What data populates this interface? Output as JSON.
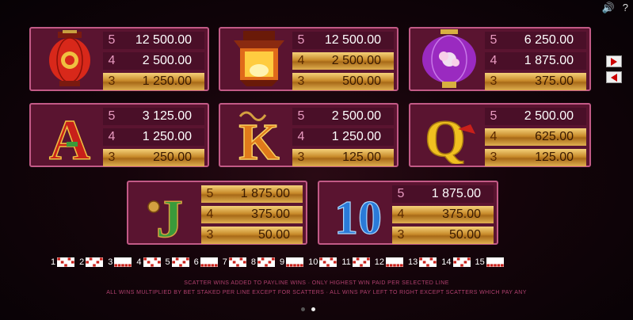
{
  "controls": {
    "sound_icon": "speaker-icon",
    "help_label": "?"
  },
  "paytable": [
    {
      "symbol": "red-lantern",
      "pays": [
        [
          "5",
          "12 500.00"
        ],
        [
          "4",
          "2 500.00"
        ],
        [
          "3",
          "1 250.00"
        ]
      ]
    },
    {
      "symbol": "gold-lantern",
      "pays": [
        [
          "5",
          "12 500.00"
        ],
        [
          "4",
          "2 500.00"
        ],
        [
          "3",
          "500.00"
        ]
      ]
    },
    {
      "symbol": "purple-lantern",
      "pays": [
        [
          "5",
          "6 250.00"
        ],
        [
          "4",
          "1 875.00"
        ],
        [
          "3",
          "375.00"
        ]
      ]
    },
    {
      "symbol": "A",
      "pays": [
        [
          "5",
          "3 125.00"
        ],
        [
          "4",
          "1 250.00"
        ],
        [
          "3",
          "250.00"
        ]
      ]
    },
    {
      "symbol": "K",
      "pays": [
        [
          "5",
          "2 500.00"
        ],
        [
          "4",
          "1 250.00"
        ],
        [
          "3",
          "125.00"
        ]
      ]
    },
    {
      "symbol": "Q",
      "pays": [
        [
          "5",
          "2 500.00"
        ],
        [
          "4",
          "625.00"
        ],
        [
          "3",
          "125.00"
        ]
      ]
    },
    {
      "symbol": "J",
      "pays": [
        [
          "5",
          "1 875.00"
        ],
        [
          "4",
          "375.00"
        ],
        [
          "3",
          "50.00"
        ]
      ]
    },
    {
      "symbol": "10",
      "pays": [
        [
          "5",
          "1 875.00"
        ],
        [
          "4",
          "375.00"
        ],
        [
          "3",
          "50.00"
        ]
      ]
    }
  ],
  "paylines": [
    "1",
    "2",
    "3",
    "4",
    "5",
    "6",
    "7",
    "8",
    "9",
    "10",
    "11",
    "12",
    "13",
    "14",
    "15"
  ],
  "footer": {
    "line1": "SCATTER WINS ADDED TO PAYLINE WINS  ·  ONLY HIGHEST WIN PAID PER SELECTED LINE",
    "line2": "ALL WINS MULTIPLIED BY BET STAKED PER LINE EXCEPT FOR SCATTERS  ·  ALL WINS PAY LEFT TO RIGHT EXCEPT SCATTERS WHICH PAY ANY"
  },
  "colors": {
    "gold": "#d4a040",
    "panel": "#5a1430",
    "border": "#c25a86",
    "red": "#c8201a",
    "green": "#3a9a3a",
    "blue": "#2a7ad8"
  }
}
